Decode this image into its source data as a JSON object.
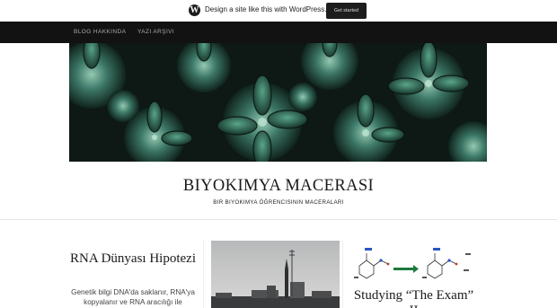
{
  "promo": {
    "logo": "W",
    "text": "Design a site like this with WordPress.com",
    "button": "Get started"
  },
  "nav": {
    "items": [
      {
        "label": "Blog Hakkinda"
      },
      {
        "label": "Yazı Arşivi"
      }
    ]
  },
  "header": {
    "image_icon": "succulents-photo",
    "site_title": "Biyokimya Macerası",
    "site_description": "Bir biyokimya öğrencisinin maceraları"
  },
  "posts": [
    {
      "title": "RNA Dünyası Hipotezi",
      "excerpt": "Genetik bilgi DNA'da saklanır, RNA'ya kopyalanır ve RNA aracılığı ile proteinlere aktarılır."
    },
    {
      "image_icon": "city-skyline-photo"
    },
    {
      "image_icon": "chemical-structures-diagram",
      "title": "Studying “The Exam” II"
    }
  ],
  "colors": {
    "nav_bg": "#121212",
    "nav_text": "#a9a9a9",
    "promo_button_bg": "#1d1d1d"
  }
}
